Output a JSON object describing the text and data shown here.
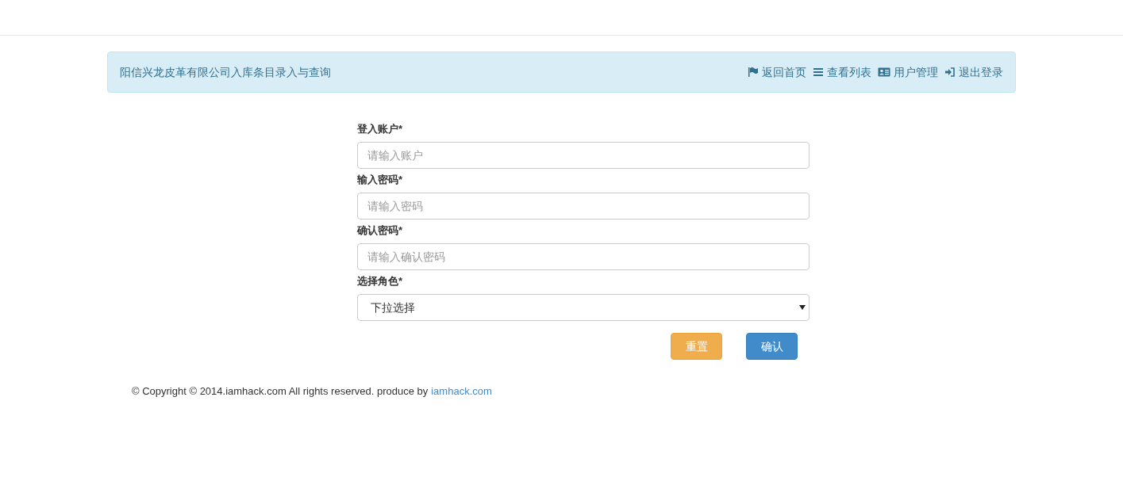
{
  "header": {
    "title": "阳信兴龙皮革有限公司入库条目录入与查询",
    "nav": [
      {
        "kind": "flag",
        "label": "返回首页"
      },
      {
        "kind": "list",
        "label": "查看列表"
      },
      {
        "kind": "card",
        "label": "用户管理"
      },
      {
        "kind": "signout",
        "label": "退出登录"
      }
    ]
  },
  "form": {
    "fields": [
      {
        "kind": "text",
        "label": "登入账户*",
        "placeholder": "请输入账户"
      },
      {
        "kind": "text",
        "label": "输入密码*",
        "placeholder": "请输入密码"
      },
      {
        "kind": "text",
        "label": "确认密码*",
        "placeholder": "请输入确认密码"
      },
      {
        "kind": "select",
        "label": "选择角色*",
        "value": "下拉选择"
      }
    ],
    "buttons": [
      {
        "kind": "warning",
        "label": "重置"
      },
      {
        "kind": "primary",
        "label": "确认"
      }
    ]
  },
  "footer": {
    "text": "© Copyright © 2014.iamhack.com All rights reserved. produce by",
    "link": "iamhack.com"
  }
}
